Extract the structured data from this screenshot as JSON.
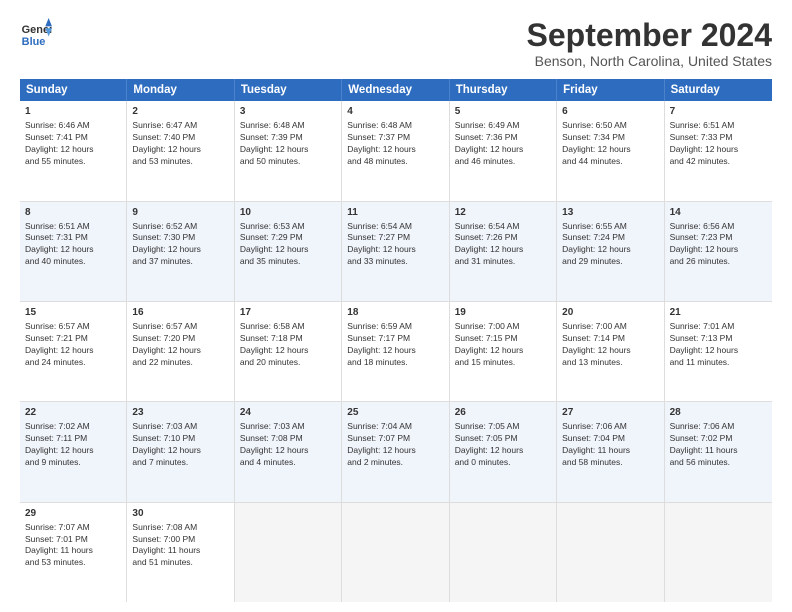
{
  "header": {
    "logo_line1": "General",
    "logo_line2": "Blue",
    "month": "September 2024",
    "location": "Benson, North Carolina, United States"
  },
  "weekdays": [
    "Sunday",
    "Monday",
    "Tuesday",
    "Wednesday",
    "Thursday",
    "Friday",
    "Saturday"
  ],
  "rows": [
    {
      "alt": false,
      "cells": [
        {
          "day": "1",
          "lines": [
            "Sunrise: 6:46 AM",
            "Sunset: 7:41 PM",
            "Daylight: 12 hours",
            "and 55 minutes."
          ]
        },
        {
          "day": "2",
          "lines": [
            "Sunrise: 6:47 AM",
            "Sunset: 7:40 PM",
            "Daylight: 12 hours",
            "and 53 minutes."
          ]
        },
        {
          "day": "3",
          "lines": [
            "Sunrise: 6:48 AM",
            "Sunset: 7:39 PM",
            "Daylight: 12 hours",
            "and 50 minutes."
          ]
        },
        {
          "day": "4",
          "lines": [
            "Sunrise: 6:48 AM",
            "Sunset: 7:37 PM",
            "Daylight: 12 hours",
            "and 48 minutes."
          ]
        },
        {
          "day": "5",
          "lines": [
            "Sunrise: 6:49 AM",
            "Sunset: 7:36 PM",
            "Daylight: 12 hours",
            "and 46 minutes."
          ]
        },
        {
          "day": "6",
          "lines": [
            "Sunrise: 6:50 AM",
            "Sunset: 7:34 PM",
            "Daylight: 12 hours",
            "and 44 minutes."
          ]
        },
        {
          "day": "7",
          "lines": [
            "Sunrise: 6:51 AM",
            "Sunset: 7:33 PM",
            "Daylight: 12 hours",
            "and 42 minutes."
          ]
        }
      ]
    },
    {
      "alt": true,
      "cells": [
        {
          "day": "8",
          "lines": [
            "Sunrise: 6:51 AM",
            "Sunset: 7:31 PM",
            "Daylight: 12 hours",
            "and 40 minutes."
          ]
        },
        {
          "day": "9",
          "lines": [
            "Sunrise: 6:52 AM",
            "Sunset: 7:30 PM",
            "Daylight: 12 hours",
            "and 37 minutes."
          ]
        },
        {
          "day": "10",
          "lines": [
            "Sunrise: 6:53 AM",
            "Sunset: 7:29 PM",
            "Daylight: 12 hours",
            "and 35 minutes."
          ]
        },
        {
          "day": "11",
          "lines": [
            "Sunrise: 6:54 AM",
            "Sunset: 7:27 PM",
            "Daylight: 12 hours",
            "and 33 minutes."
          ]
        },
        {
          "day": "12",
          "lines": [
            "Sunrise: 6:54 AM",
            "Sunset: 7:26 PM",
            "Daylight: 12 hours",
            "and 31 minutes."
          ]
        },
        {
          "day": "13",
          "lines": [
            "Sunrise: 6:55 AM",
            "Sunset: 7:24 PM",
            "Daylight: 12 hours",
            "and 29 minutes."
          ]
        },
        {
          "day": "14",
          "lines": [
            "Sunrise: 6:56 AM",
            "Sunset: 7:23 PM",
            "Daylight: 12 hours",
            "and 26 minutes."
          ]
        }
      ]
    },
    {
      "alt": false,
      "cells": [
        {
          "day": "15",
          "lines": [
            "Sunrise: 6:57 AM",
            "Sunset: 7:21 PM",
            "Daylight: 12 hours",
            "and 24 minutes."
          ]
        },
        {
          "day": "16",
          "lines": [
            "Sunrise: 6:57 AM",
            "Sunset: 7:20 PM",
            "Daylight: 12 hours",
            "and 22 minutes."
          ]
        },
        {
          "day": "17",
          "lines": [
            "Sunrise: 6:58 AM",
            "Sunset: 7:18 PM",
            "Daylight: 12 hours",
            "and 20 minutes."
          ]
        },
        {
          "day": "18",
          "lines": [
            "Sunrise: 6:59 AM",
            "Sunset: 7:17 PM",
            "Daylight: 12 hours",
            "and 18 minutes."
          ]
        },
        {
          "day": "19",
          "lines": [
            "Sunrise: 7:00 AM",
            "Sunset: 7:15 PM",
            "Daylight: 12 hours",
            "and 15 minutes."
          ]
        },
        {
          "day": "20",
          "lines": [
            "Sunrise: 7:00 AM",
            "Sunset: 7:14 PM",
            "Daylight: 12 hours",
            "and 13 minutes."
          ]
        },
        {
          "day": "21",
          "lines": [
            "Sunrise: 7:01 AM",
            "Sunset: 7:13 PM",
            "Daylight: 12 hours",
            "and 11 minutes."
          ]
        }
      ]
    },
    {
      "alt": true,
      "cells": [
        {
          "day": "22",
          "lines": [
            "Sunrise: 7:02 AM",
            "Sunset: 7:11 PM",
            "Daylight: 12 hours",
            "and 9 minutes."
          ]
        },
        {
          "day": "23",
          "lines": [
            "Sunrise: 7:03 AM",
            "Sunset: 7:10 PM",
            "Daylight: 12 hours",
            "and 7 minutes."
          ]
        },
        {
          "day": "24",
          "lines": [
            "Sunrise: 7:03 AM",
            "Sunset: 7:08 PM",
            "Daylight: 12 hours",
            "and 4 minutes."
          ]
        },
        {
          "day": "25",
          "lines": [
            "Sunrise: 7:04 AM",
            "Sunset: 7:07 PM",
            "Daylight: 12 hours",
            "and 2 minutes."
          ]
        },
        {
          "day": "26",
          "lines": [
            "Sunrise: 7:05 AM",
            "Sunset: 7:05 PM",
            "Daylight: 12 hours",
            "and 0 minutes."
          ]
        },
        {
          "day": "27",
          "lines": [
            "Sunrise: 7:06 AM",
            "Sunset: 7:04 PM",
            "Daylight: 11 hours",
            "and 58 minutes."
          ]
        },
        {
          "day": "28",
          "lines": [
            "Sunrise: 7:06 AM",
            "Sunset: 7:02 PM",
            "Daylight: 11 hours",
            "and 56 minutes."
          ]
        }
      ]
    },
    {
      "alt": false,
      "cells": [
        {
          "day": "29",
          "lines": [
            "Sunrise: 7:07 AM",
            "Sunset: 7:01 PM",
            "Daylight: 11 hours",
            "and 53 minutes."
          ]
        },
        {
          "day": "30",
          "lines": [
            "Sunrise: 7:08 AM",
            "Sunset: 7:00 PM",
            "Daylight: 11 hours",
            "and 51 minutes."
          ]
        },
        {
          "day": "",
          "lines": []
        },
        {
          "day": "",
          "lines": []
        },
        {
          "day": "",
          "lines": []
        },
        {
          "day": "",
          "lines": []
        },
        {
          "day": "",
          "lines": []
        }
      ]
    }
  ]
}
